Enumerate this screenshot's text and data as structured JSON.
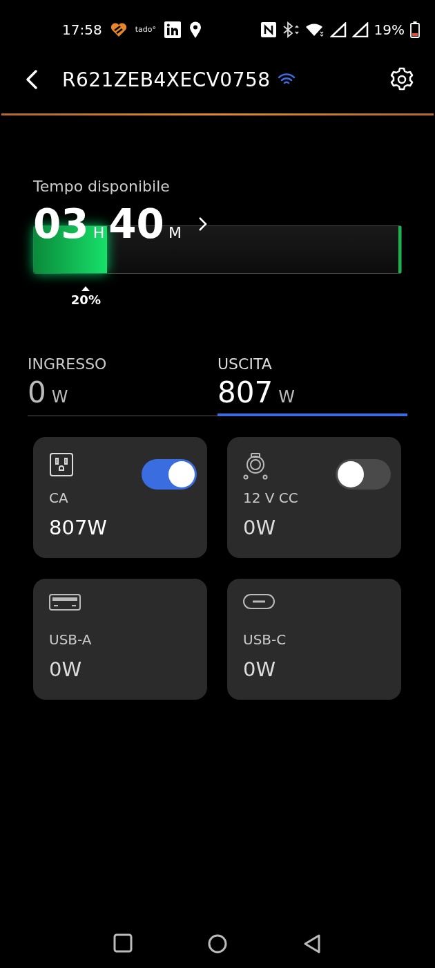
{
  "status_bar": {
    "time": "17:58",
    "tado": "tado°",
    "battery": "19%"
  },
  "header": {
    "title": "R621ZEB4XECV0758"
  },
  "runtime": {
    "label": "Tempo disponibile",
    "hours": "03",
    "hours_unit": "H",
    "minutes": "40",
    "minutes_unit": "M",
    "level": 0.2,
    "reading": "20%"
  },
  "tabs": [
    {
      "label": "INGRESSO",
      "value": "0",
      "unit": "W",
      "selected": false
    },
    {
      "label": "USCITA",
      "value": "807",
      "unit": "W",
      "selected": true
    }
  ],
  "outputs": [
    {
      "kind": "ac",
      "name": "CA",
      "power": "807W",
      "switch": {
        "on": true
      }
    },
    {
      "kind": "dc",
      "name": "12 V CC",
      "power": "0W",
      "switch": {
        "on": false
      }
    },
    {
      "kind": "usb_a",
      "name": "USB-A",
      "power": "0W"
    },
    {
      "kind": "usb_c",
      "name": "USB-C",
      "power": "0W"
    }
  ]
}
